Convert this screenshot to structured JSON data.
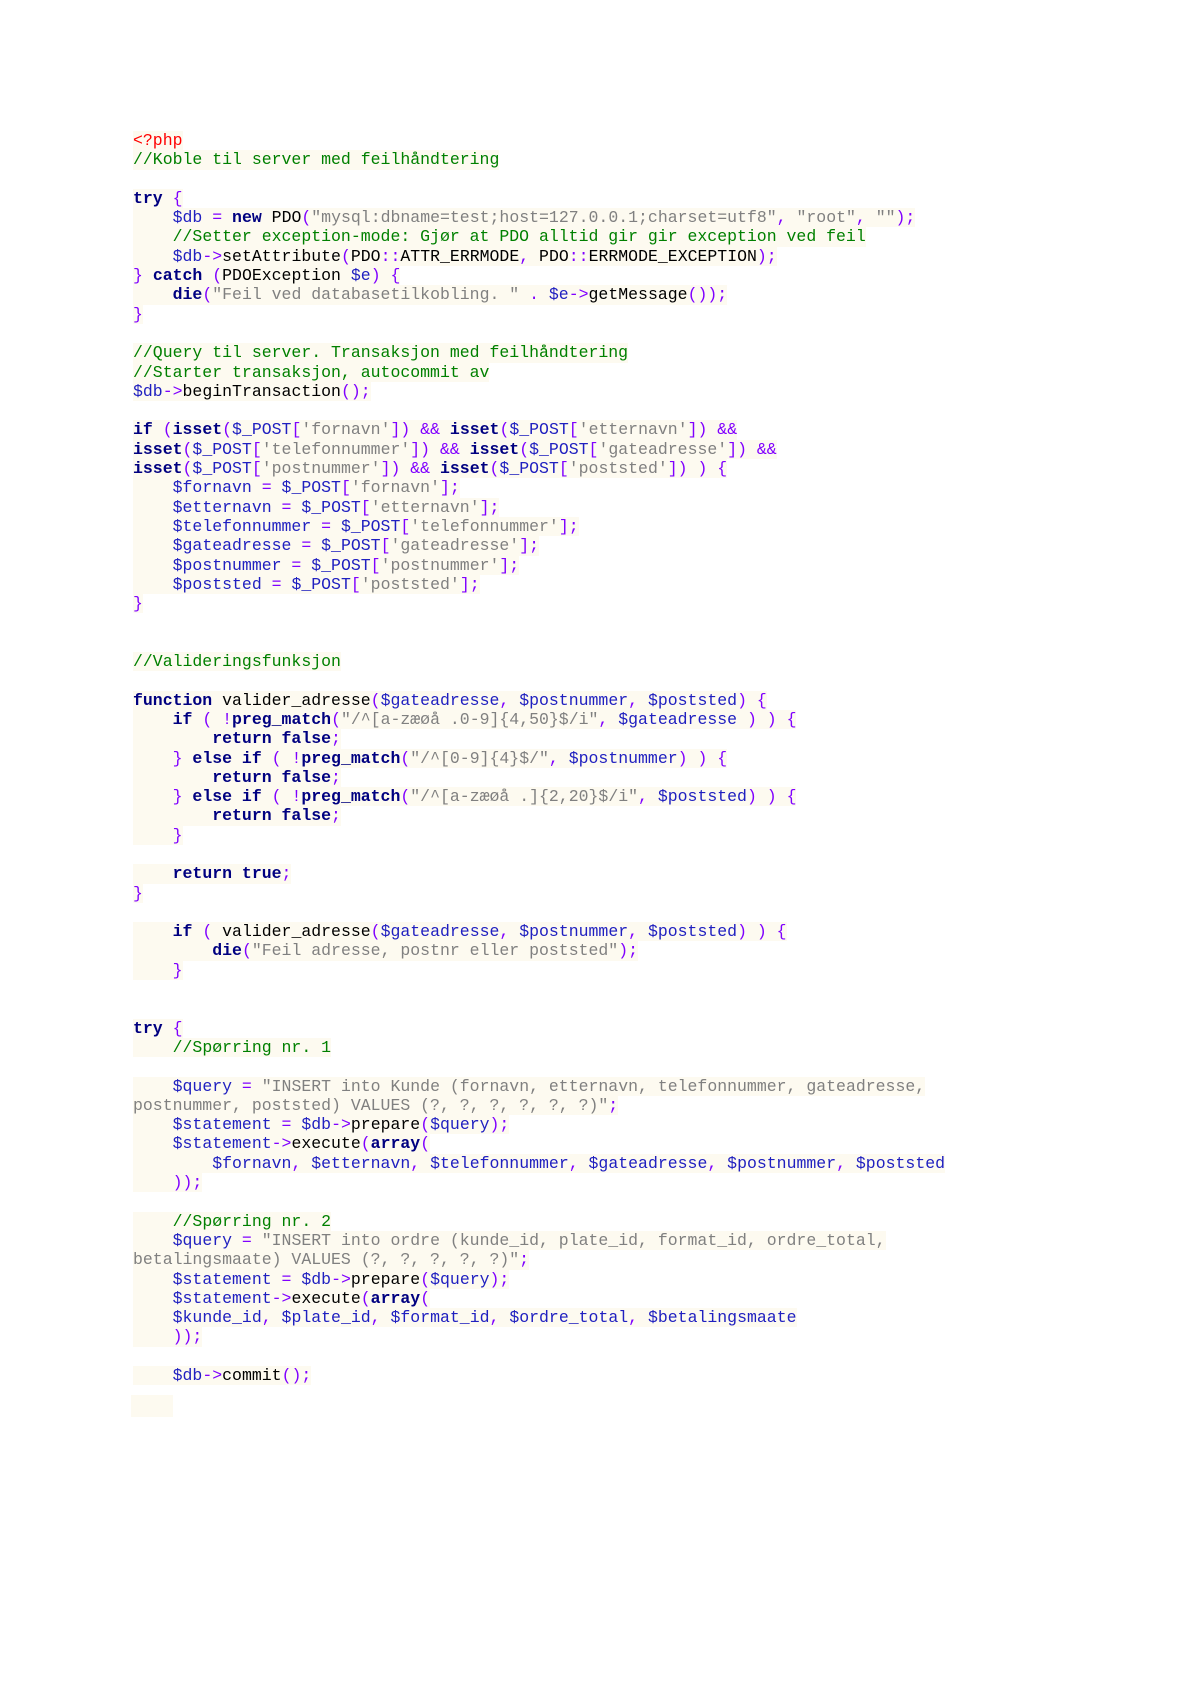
{
  "document": {
    "language": "php",
    "lines": [
      [
        [
          "t",
          "<?php"
        ]
      ],
      [
        [
          "c",
          "//Koble til server med feilhåndtering"
        ]
      ],
      [],
      [
        [
          "k",
          "try"
        ],
        [
          "o",
          " {"
        ]
      ],
      [
        [
          "f",
          "    "
        ],
        [
          "v",
          "$db"
        ],
        [
          "o",
          " = "
        ],
        [
          "k",
          "new"
        ],
        [
          "f",
          " PDO"
        ],
        [
          "o",
          "("
        ],
        [
          "s",
          "\"mysql:dbname=test;host=127.0.0.1;charset=utf8\""
        ],
        [
          "o",
          ", "
        ],
        [
          "s",
          "\"root\""
        ],
        [
          "o",
          ", "
        ],
        [
          "s",
          "\"\""
        ],
        [
          "o",
          ");"
        ]
      ],
      [
        [
          "f",
          "    "
        ],
        [
          "c",
          "//Setter exception-mode: Gjør at PDO alltid gir gir exception ved feil"
        ]
      ],
      [
        [
          "f",
          "    "
        ],
        [
          "v",
          "$db"
        ],
        [
          "o",
          "->"
        ],
        [
          "f",
          "setAttribute"
        ],
        [
          "o",
          "("
        ],
        [
          "f",
          "PDO"
        ],
        [
          "o",
          "::"
        ],
        [
          "f",
          "ATTR_ERRMODE"
        ],
        [
          "o",
          ", "
        ],
        [
          "f",
          "PDO"
        ],
        [
          "o",
          "::"
        ],
        [
          "f",
          "ERRMODE_EXCEPTION"
        ],
        [
          "o",
          ");"
        ]
      ],
      [
        [
          "o",
          "} "
        ],
        [
          "k",
          "catch"
        ],
        [
          "o",
          " ("
        ],
        [
          "f",
          "PDOException "
        ],
        [
          "v",
          "$e"
        ],
        [
          "o",
          ") {"
        ]
      ],
      [
        [
          "f",
          "    "
        ],
        [
          "k",
          "die"
        ],
        [
          "o",
          "("
        ],
        [
          "s",
          "\"Feil ved databasetilkobling. \""
        ],
        [
          "o",
          " . "
        ],
        [
          "v",
          "$e"
        ],
        [
          "o",
          "->"
        ],
        [
          "f",
          "getMessage"
        ],
        [
          "o",
          "());"
        ]
      ],
      [
        [
          "o",
          "}"
        ]
      ],
      [],
      [
        [
          "c",
          "//Query til server. Transaksjon med feilhåndtering"
        ]
      ],
      [
        [
          "c",
          "//Starter transaksjon, autocommit av"
        ]
      ],
      [
        [
          "v",
          "$db"
        ],
        [
          "o",
          "->"
        ],
        [
          "f",
          "beginTransaction"
        ],
        [
          "o",
          "();"
        ]
      ],
      [],
      [
        [
          "k",
          "if"
        ],
        [
          "o",
          " ("
        ],
        [
          "k",
          "isset"
        ],
        [
          "o",
          "("
        ],
        [
          "v",
          "$_POST"
        ],
        [
          "o",
          "["
        ],
        [
          "s",
          "'fornavn'"
        ],
        [
          "o",
          "]) && "
        ],
        [
          "k",
          "isset"
        ],
        [
          "o",
          "("
        ],
        [
          "v",
          "$_POST"
        ],
        [
          "o",
          "["
        ],
        [
          "s",
          "'etternavn'"
        ],
        [
          "o",
          "]) &&"
        ]
      ],
      [
        [
          "k",
          "isset"
        ],
        [
          "o",
          "("
        ],
        [
          "v",
          "$_POST"
        ],
        [
          "o",
          "["
        ],
        [
          "s",
          "'telefonnummer'"
        ],
        [
          "o",
          "]) && "
        ],
        [
          "k",
          "isset"
        ],
        [
          "o",
          "("
        ],
        [
          "v",
          "$_POST"
        ],
        [
          "o",
          "["
        ],
        [
          "s",
          "'gateadresse'"
        ],
        [
          "o",
          "]) &&"
        ]
      ],
      [
        [
          "k",
          "isset"
        ],
        [
          "o",
          "("
        ],
        [
          "v",
          "$_POST"
        ],
        [
          "o",
          "["
        ],
        [
          "s",
          "'postnummer'"
        ],
        [
          "o",
          "]) && "
        ],
        [
          "k",
          "isset"
        ],
        [
          "o",
          "("
        ],
        [
          "v",
          "$_POST"
        ],
        [
          "o",
          "["
        ],
        [
          "s",
          "'poststed'"
        ],
        [
          "o",
          "]) ) {"
        ]
      ],
      [
        [
          "f",
          "    "
        ],
        [
          "v",
          "$fornavn"
        ],
        [
          "o",
          " = "
        ],
        [
          "v",
          "$_POST"
        ],
        [
          "o",
          "["
        ],
        [
          "s",
          "'fornavn'"
        ],
        [
          "o",
          "];"
        ]
      ],
      [
        [
          "f",
          "    "
        ],
        [
          "v",
          "$etternavn"
        ],
        [
          "o",
          " = "
        ],
        [
          "v",
          "$_POST"
        ],
        [
          "o",
          "["
        ],
        [
          "s",
          "'etternavn'"
        ],
        [
          "o",
          "];"
        ]
      ],
      [
        [
          "f",
          "    "
        ],
        [
          "v",
          "$telefonnummer"
        ],
        [
          "o",
          " = "
        ],
        [
          "v",
          "$_POST"
        ],
        [
          "o",
          "["
        ],
        [
          "s",
          "'telefonnummer'"
        ],
        [
          "o",
          "];"
        ]
      ],
      [
        [
          "f",
          "    "
        ],
        [
          "v",
          "$gateadresse"
        ],
        [
          "o",
          " = "
        ],
        [
          "v",
          "$_POST"
        ],
        [
          "o",
          "["
        ],
        [
          "s",
          "'gateadresse'"
        ],
        [
          "o",
          "];"
        ]
      ],
      [
        [
          "f",
          "    "
        ],
        [
          "v",
          "$postnummer"
        ],
        [
          "o",
          " = "
        ],
        [
          "v",
          "$_POST"
        ],
        [
          "o",
          "["
        ],
        [
          "s",
          "'postnummer'"
        ],
        [
          "o",
          "];"
        ]
      ],
      [
        [
          "f",
          "    "
        ],
        [
          "v",
          "$poststed"
        ],
        [
          "o",
          " = "
        ],
        [
          "v",
          "$_POST"
        ],
        [
          "o",
          "["
        ],
        [
          "s",
          "'poststed'"
        ],
        [
          "o",
          "];"
        ]
      ],
      [
        [
          "o",
          "}"
        ]
      ],
      [],
      [],
      [
        [
          "c",
          "//Valideringsfunksjon"
        ]
      ],
      [],
      [
        [
          "k",
          "function"
        ],
        [
          "f",
          " valider_adresse"
        ],
        [
          "o",
          "("
        ],
        [
          "v",
          "$gateadresse"
        ],
        [
          "o",
          ", "
        ],
        [
          "v",
          "$postnummer"
        ],
        [
          "o",
          ", "
        ],
        [
          "v",
          "$poststed"
        ],
        [
          "o",
          ") {"
        ]
      ],
      [
        [
          "f",
          "    "
        ],
        [
          "k",
          "if"
        ],
        [
          "o",
          " ( !"
        ],
        [
          "k",
          "preg_match"
        ],
        [
          "o",
          "("
        ],
        [
          "s",
          "\"/^[a-zæøå .0-9]{4,50}$/i\""
        ],
        [
          "o",
          ", "
        ],
        [
          "v",
          "$gateadresse"
        ],
        [
          "o",
          " ) ) {"
        ]
      ],
      [
        [
          "f",
          "        "
        ],
        [
          "k",
          "return false"
        ],
        [
          "o",
          ";"
        ]
      ],
      [
        [
          "f",
          "    "
        ],
        [
          "o",
          "} "
        ],
        [
          "k",
          "else if"
        ],
        [
          "o",
          " ( !"
        ],
        [
          "k",
          "preg_match"
        ],
        [
          "o",
          "("
        ],
        [
          "s",
          "\"/^[0-9]{4}$/\""
        ],
        [
          "o",
          ", "
        ],
        [
          "v",
          "$postnummer"
        ],
        [
          "o",
          ") ) {"
        ]
      ],
      [
        [
          "f",
          "        "
        ],
        [
          "k",
          "return false"
        ],
        [
          "o",
          ";"
        ]
      ],
      [
        [
          "f",
          "    "
        ],
        [
          "o",
          "} "
        ],
        [
          "k",
          "else if"
        ],
        [
          "o",
          " ( !"
        ],
        [
          "k",
          "preg_match"
        ],
        [
          "o",
          "("
        ],
        [
          "s",
          "\"/^[a-zæøå .]{2,20}$/i\""
        ],
        [
          "o",
          ", "
        ],
        [
          "v",
          "$poststed"
        ],
        [
          "o",
          ") ) {"
        ]
      ],
      [
        [
          "f",
          "        "
        ],
        [
          "k",
          "return false"
        ],
        [
          "o",
          ";"
        ]
      ],
      [
        [
          "f",
          "    "
        ],
        [
          "o",
          "}"
        ]
      ],
      [],
      [
        [
          "f",
          "    "
        ],
        [
          "k",
          "return true"
        ],
        [
          "o",
          ";"
        ]
      ],
      [
        [
          "o",
          "}"
        ]
      ],
      [],
      [
        [
          "f",
          "    "
        ],
        [
          "k",
          "if"
        ],
        [
          "o",
          " ( "
        ],
        [
          "f",
          "valider_adresse"
        ],
        [
          "o",
          "("
        ],
        [
          "v",
          "$gateadresse"
        ],
        [
          "o",
          ", "
        ],
        [
          "v",
          "$postnummer"
        ],
        [
          "o",
          ", "
        ],
        [
          "v",
          "$poststed"
        ],
        [
          "o",
          ") ) {"
        ]
      ],
      [
        [
          "f",
          "        "
        ],
        [
          "k",
          "die"
        ],
        [
          "o",
          "("
        ],
        [
          "s",
          "\"Feil adresse, postnr eller poststed\""
        ],
        [
          "o",
          ");"
        ]
      ],
      [
        [
          "f",
          "    "
        ],
        [
          "o",
          "}"
        ]
      ],
      [],
      [],
      [
        [
          "k",
          "try"
        ],
        [
          "o",
          " {"
        ]
      ],
      [
        [
          "f",
          "    "
        ],
        [
          "c",
          "//Spørring nr. 1"
        ]
      ],
      [],
      [
        [
          "f",
          "    "
        ],
        [
          "v",
          "$query"
        ],
        [
          "o",
          " = "
        ],
        [
          "s",
          "\"INSERT into Kunde (fornavn, etternavn, telefonnummer, gateadresse,"
        ]
      ],
      [
        [
          "s",
          "postnummer, poststed) VALUES (?, ?, ?, ?, ?, ?)\""
        ],
        [
          "o",
          ";"
        ]
      ],
      [
        [
          "f",
          "    "
        ],
        [
          "v",
          "$statement"
        ],
        [
          "o",
          " = "
        ],
        [
          "v",
          "$db"
        ],
        [
          "o",
          "->"
        ],
        [
          "f",
          "prepare"
        ],
        [
          "o",
          "("
        ],
        [
          "v",
          "$query"
        ],
        [
          "o",
          ");"
        ]
      ],
      [
        [
          "f",
          "    "
        ],
        [
          "v",
          "$statement"
        ],
        [
          "o",
          "->"
        ],
        [
          "f",
          "execute"
        ],
        [
          "o",
          "("
        ],
        [
          "k",
          "array"
        ],
        [
          "o",
          "("
        ]
      ],
      [
        [
          "f",
          "        "
        ],
        [
          "v",
          "$fornavn"
        ],
        [
          "o",
          ", "
        ],
        [
          "v",
          "$etternavn"
        ],
        [
          "o",
          ", "
        ],
        [
          "v",
          "$telefonnummer"
        ],
        [
          "o",
          ", "
        ],
        [
          "v",
          "$gateadresse"
        ],
        [
          "o",
          ", "
        ],
        [
          "v",
          "$postnummer"
        ],
        [
          "o",
          ", "
        ],
        [
          "v",
          "$poststed"
        ]
      ],
      [
        [
          "f",
          "    "
        ],
        [
          "o",
          "));"
        ]
      ],
      [],
      [
        [
          "f",
          "    "
        ],
        [
          "c",
          "//Spørring nr. 2"
        ]
      ],
      [
        [
          "f",
          "    "
        ],
        [
          "v",
          "$query"
        ],
        [
          "o",
          " = "
        ],
        [
          "s",
          "\"INSERT into ordre (kunde_id, plate_id, format_id, ordre_total,"
        ]
      ],
      [
        [
          "s",
          "betalingsmaate) VALUES (?, ?, ?, ?, ?)\""
        ],
        [
          "o",
          ";"
        ]
      ],
      [
        [
          "f",
          "    "
        ],
        [
          "v",
          "$statement"
        ],
        [
          "o",
          " = "
        ],
        [
          "v",
          "$db"
        ],
        [
          "o",
          "->"
        ],
        [
          "f",
          "prepare"
        ],
        [
          "o",
          "("
        ],
        [
          "v",
          "$query"
        ],
        [
          "o",
          ");"
        ]
      ],
      [
        [
          "f",
          "    "
        ],
        [
          "v",
          "$statement"
        ],
        [
          "o",
          "->"
        ],
        [
          "f",
          "execute"
        ],
        [
          "o",
          "("
        ],
        [
          "k",
          "array"
        ],
        [
          "o",
          "("
        ]
      ],
      [
        [
          "f",
          "    "
        ],
        [
          "v",
          "$kunde_id"
        ],
        [
          "o",
          ", "
        ],
        [
          "v",
          "$plate_id"
        ],
        [
          "o",
          ", "
        ],
        [
          "v",
          "$format_id"
        ],
        [
          "o",
          ", "
        ],
        [
          "v",
          "$ordre_total"
        ],
        [
          "o",
          ", "
        ],
        [
          "v",
          "$betalingsmaate"
        ]
      ],
      [
        [
          "f",
          "    "
        ],
        [
          "o",
          "));"
        ]
      ],
      [],
      [
        [
          "f",
          "    "
        ],
        [
          "v",
          "$db"
        ],
        [
          "o",
          "->"
        ],
        [
          "f",
          "commit"
        ],
        [
          "o",
          "();"
        ]
      ]
    ]
  },
  "colors": {
    "php_tag": "#ff0000",
    "comment": "#008000",
    "keyword": "#000080",
    "variable": "#2020c0",
    "operator": "#8000ff",
    "string": "#808080",
    "highlight": "#fdfaf0"
  }
}
